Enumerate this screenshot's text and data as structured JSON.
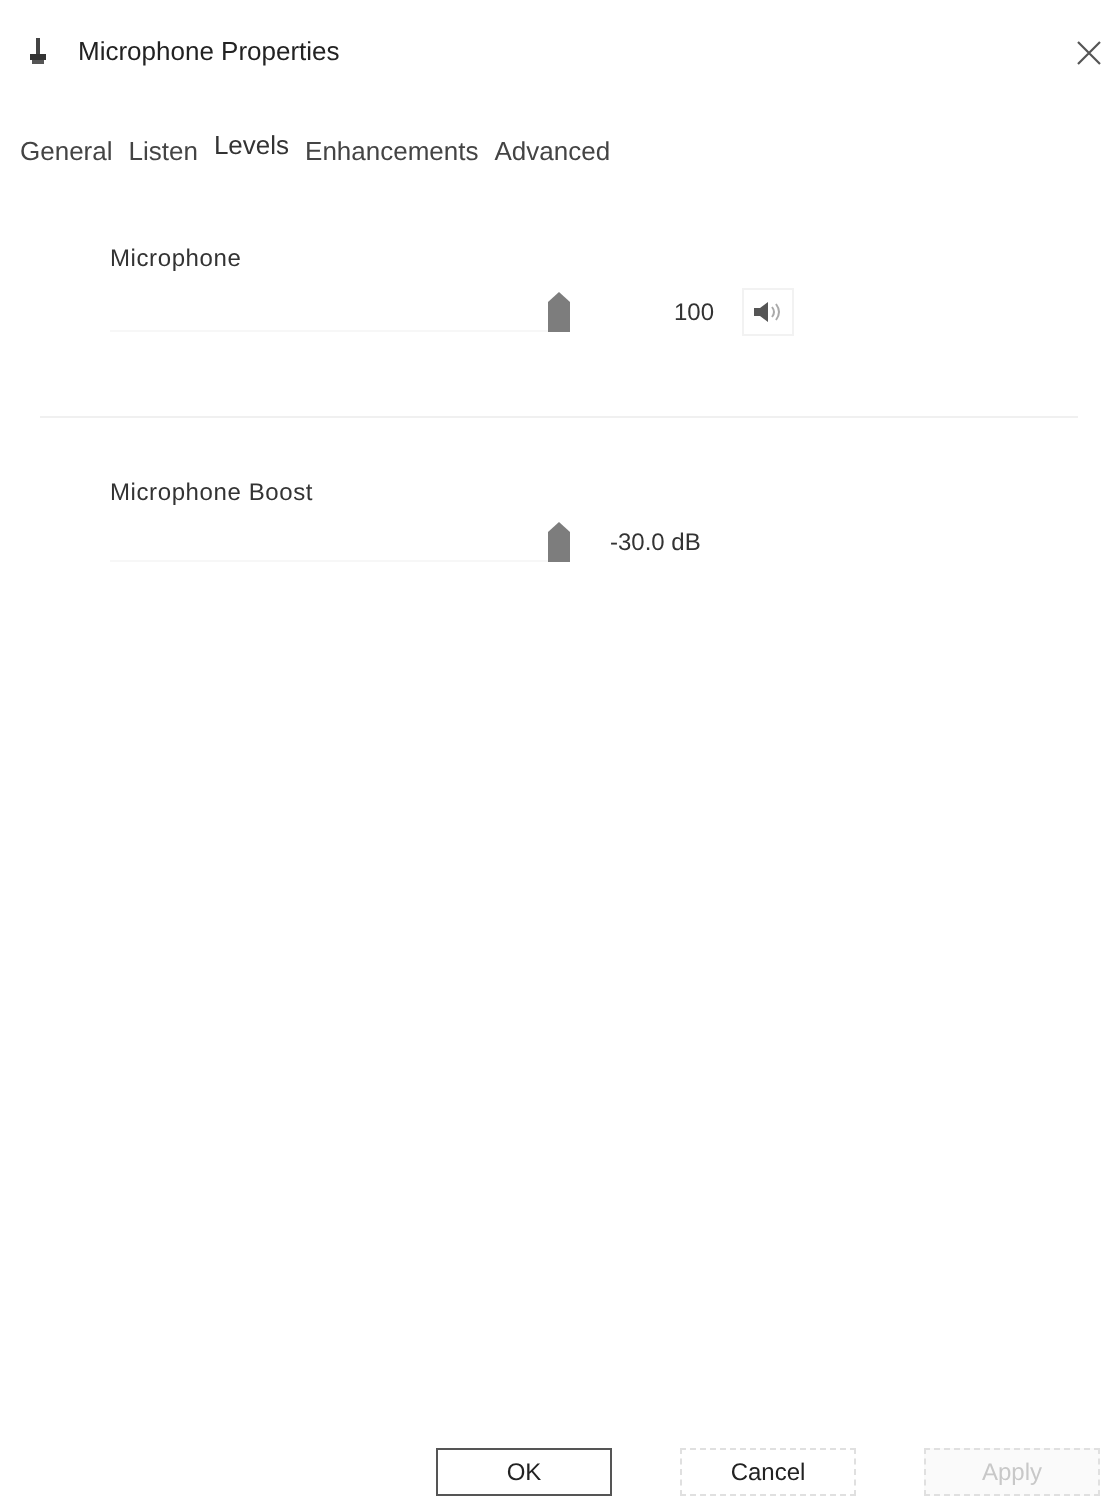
{
  "window": {
    "title": "Microphone Properties"
  },
  "tabs": [
    {
      "label": "General",
      "selected": false
    },
    {
      "label": "Listen",
      "selected": false
    },
    {
      "label": "Levels",
      "selected": true
    },
    {
      "label": "Enhancements",
      "selected": false
    },
    {
      "label": "Advanced",
      "selected": false
    }
  ],
  "levels": [
    {
      "name": "Microphone",
      "level": 1,
      "reading": "100",
      "kind": "mutable"
    },
    {
      "name": "Microphone Boost",
      "level": 1,
      "reading": "-30.0 dB",
      "kind": "plain"
    }
  ],
  "buttons": [
    {
      "label": "OK",
      "kind": "default",
      "disabled": false
    },
    {
      "label": "Cancel",
      "kind": "normal",
      "disabled": false
    },
    {
      "label": "Apply",
      "kind": "normal",
      "disabled": true
    }
  ]
}
